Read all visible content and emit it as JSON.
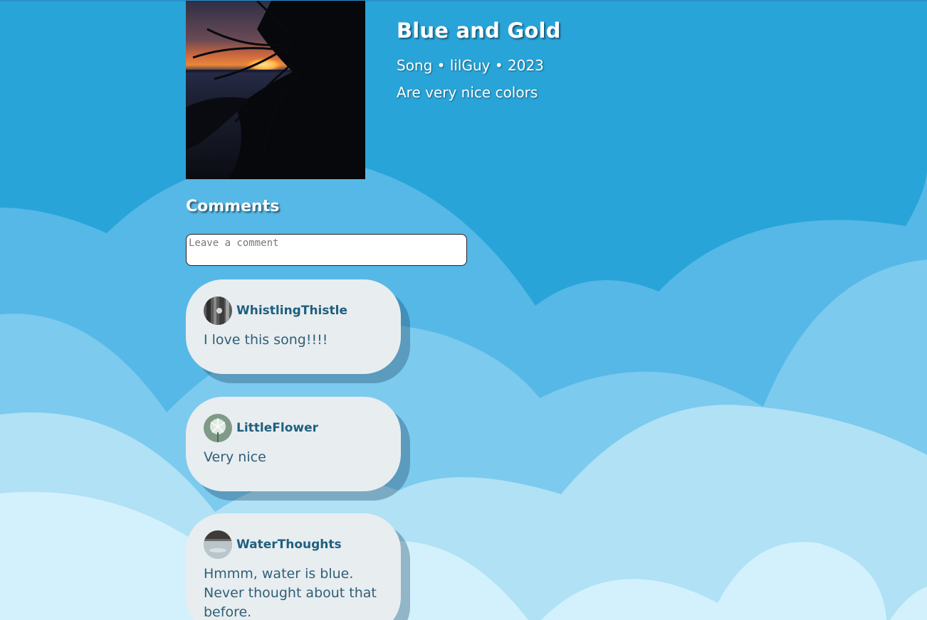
{
  "song": {
    "title": "Blue and Gold",
    "meta": "Song • lilGuy • 2023",
    "description": "Are very nice colors"
  },
  "comments_section": {
    "heading": "Comments",
    "input_placeholder": "Leave a comment",
    "items": [
      {
        "username": "WhistlingThistle",
        "text": "I love this song!!!!"
      },
      {
        "username": "LittleFlower",
        "text": "Very nice"
      },
      {
        "username": "WaterThoughts",
        "text": "Hmmm, water is blue. Never thought about that before."
      }
    ]
  },
  "colors": {
    "sky": "#28a4d8",
    "cloud_layer_1": "#56b8e6",
    "cloud_layer_2": "#7ccaee",
    "cloud_layer_3": "#b0e1f5",
    "cloud_layer_4": "#d3f1fd",
    "card": "#e8edf0",
    "username": "#1f5f7e"
  }
}
